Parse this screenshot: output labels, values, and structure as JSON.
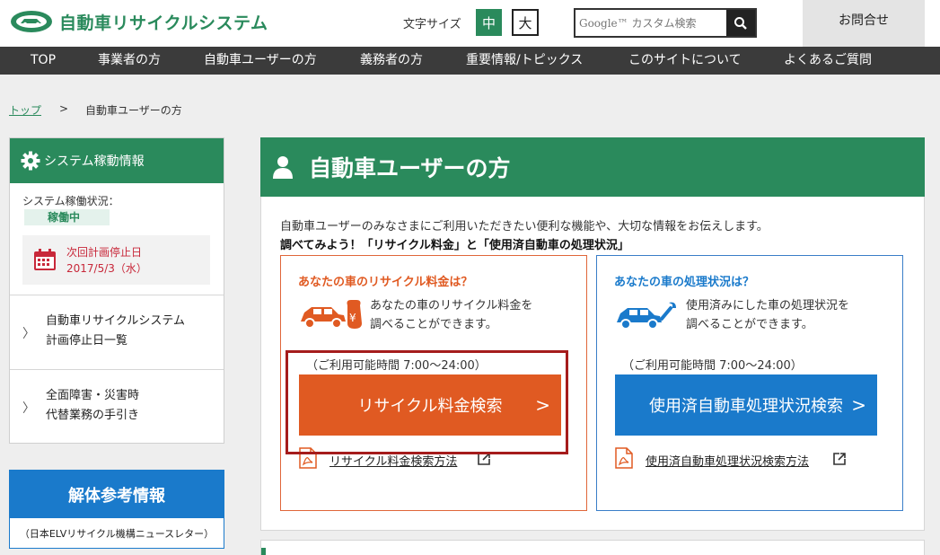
{
  "header": {
    "site_title": "自動車リサイクルシステム",
    "font_size_label": "文字サイズ",
    "font_size_medium": "中",
    "font_size_large": "大",
    "search_placeholder": "Google™ カスタム検索",
    "contact_label": "お問合せ"
  },
  "nav": {
    "items": [
      {
        "label": "TOP"
      },
      {
        "label": "事業者の方"
      },
      {
        "label": "自動車ユーザーの方"
      },
      {
        "label": "義務者の方"
      },
      {
        "label": "重要情報/トピックス"
      },
      {
        "label": "このサイトについて"
      },
      {
        "label": "よくあるご質問"
      }
    ]
  },
  "breadcrumb": {
    "home": "トップ",
    "separator": ">",
    "current": "自動車ユーザーの方"
  },
  "sidebar": {
    "system_title": "システム稼動情報",
    "status_label": "システム稼働状況：",
    "status_value": "稼働中",
    "next_stop_title": "次回計画停止日",
    "next_stop_date": "2017/5/3（水）",
    "links": [
      {
        "line1": "自動車リサイクルシステム",
        "line2": "計画停止日一覧"
      },
      {
        "line1": "全面障害・災害時",
        "line2": "代替業務の手引き"
      }
    ],
    "kaitai_title": "解体参考情報",
    "kaitai_subtitle": "（日本ELVリサイクル機構ニュースレター）"
  },
  "main": {
    "title": "自動車ユーザーの方",
    "intro": "自動車ユーザーのみなさまにご利用いただきたい便利な機能や、大切な情報をお伝えします。",
    "intro_bold": "調べてみよう！「リサイクル料金」と「使用済自動車の処理状況」",
    "cards": [
      {
        "title": "あなたの車のリサイクル料金は？",
        "desc_line1": "あなたの車のリサイクル料金を",
        "desc_line2": "調べることができます。",
        "hours": "（ご利用可能時間 7:00～24:00）",
        "button": "リサイクル料金検索",
        "link": "リサイクル料金検索方法"
      },
      {
        "title": "あなたの車の処理状況は？",
        "desc_line1": "使用済みにした車の処理状況を",
        "desc_line2": "調べることができます。",
        "hours": "（ご利用可能時間 7:00～24:00）",
        "button": "使用済自動車処理状況検索",
        "link": "使用済自動車処理状況検索方法"
      }
    ]
  },
  "colors": {
    "brand_green": "#2a8a5c",
    "orange": "#e05a22",
    "blue": "#1a7acb",
    "nav_bg": "#3b3b3b",
    "alert_red": "#c8283a",
    "highlight_border": "#a51c1c"
  },
  "icons": {
    "logo": "car-logo-icon",
    "search": "search-icon",
    "gear": "gear-icon",
    "calendar": "calendar-icon",
    "chevron": "chevron-right-icon",
    "user": "user-icon",
    "car_money": "car-money-icon",
    "car_wrench": "car-wrench-icon",
    "pdf": "pdf-icon",
    "external": "external-link-icon"
  }
}
